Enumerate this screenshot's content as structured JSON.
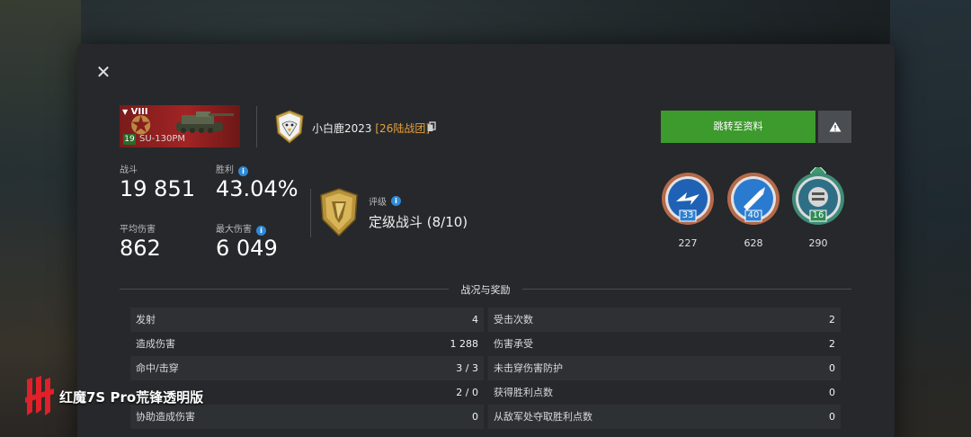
{
  "tank": {
    "tier": "VIII",
    "level": "19",
    "name": "SU-130PM"
  },
  "player": {
    "name": "小白鹿2023",
    "clan": "[26陆战团]"
  },
  "actions": {
    "profile_label": "跳转至资料"
  },
  "stats": {
    "battles_label": "战斗",
    "battles_value": "19 851",
    "winrate_label": "胜利",
    "winrate_value": "43.04%",
    "avg_damage_label": "平均伤害",
    "avg_damage_value": "862",
    "max_damage_label": "最大伤害",
    "max_damage_value": "6 049"
  },
  "rating": {
    "label": "评级",
    "value": "定级战斗 (8/10)"
  },
  "medals": [
    {
      "level": "33",
      "count": "227"
    },
    {
      "level": "40",
      "count": "628"
    },
    {
      "level": "16",
      "count": "290"
    }
  ],
  "section": {
    "title": "战况与奖励"
  },
  "left_rows": [
    {
      "label": "发射",
      "value": "4"
    },
    {
      "label": "造成伤害",
      "value": "1 288"
    },
    {
      "label": "命中/击穿",
      "value": "3 / 3"
    },
    {
      "label": "",
      "value": "2 / 0"
    },
    {
      "label": "协助造成伤害",
      "value": "0"
    }
  ],
  "right_rows": [
    {
      "label": "受击次数",
      "value": "2"
    },
    {
      "label": "伤害承受",
      "value": "2"
    },
    {
      "label": "未击穿伤害防护",
      "value": "0"
    },
    {
      "label": "获得胜利点数",
      "value": "0"
    },
    {
      "label": "从敌军处夺取胜利点数",
      "value": "0"
    }
  ],
  "watermark": {
    "text": "红魔7S Pro荒锋透明版"
  },
  "colors": {
    "accent_green": "#3d9a2d",
    "clan_orange": "#e8a13a",
    "info_blue": "#2f8ad9"
  }
}
